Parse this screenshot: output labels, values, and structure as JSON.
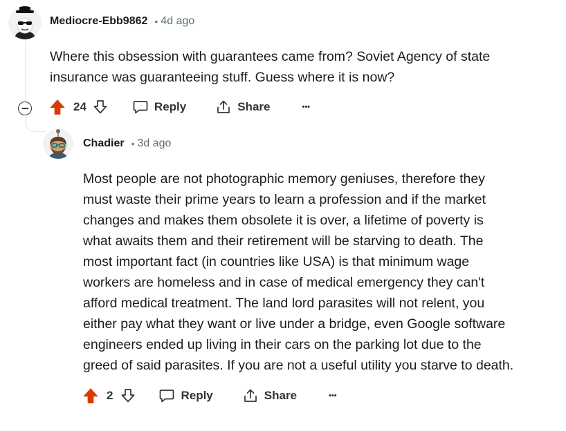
{
  "comments": [
    {
      "username": "Mediocre-Ebb9862",
      "separator": "•",
      "time": "4d ago",
      "body_lines": [
        "Where this obsession with guarantees came from? Soviet Agency of state",
        "insurance was guaranteeing stuff. Guess where it is now?"
      ],
      "votes": "24",
      "reply_label": "Reply",
      "share_label": "Share",
      "more_label": "•••"
    },
    {
      "username": "Chadier",
      "separator": "•",
      "time": "3d ago",
      "body_lines": [
        "Most people are not photographic memory geniuses, therefore they",
        "must waste their prime years to learn a profession and if the market",
        "changes and makes them obsolete it is over, a lifetime of poverty is",
        "what awaits them and their retirement will be starving to death. The",
        "most important fact (in countries like USA) is that minimum wage",
        "workers are homeless and in case of medical emergency they can't",
        "afford medical treatment. The land lord parasites will not relent, you",
        "either pay what they want or live under a bridge, even Google software",
        "engineers ended up living in their cars on the parking lot due to the",
        "greed of said parasites. If you are not a useful utility you starve to death."
      ],
      "votes": "2",
      "reply_label": "Reply",
      "share_label": "Share",
      "more_label": "•••"
    }
  ],
  "colors": {
    "upvote_active": "#d93a00",
    "thread_line": "#e5e7e8"
  },
  "icons": {
    "upvote": "arrow-up-icon",
    "downvote": "arrow-down-icon",
    "reply": "speech-bubble-icon",
    "share": "share-icon",
    "collapse": "minus-circle-icon"
  }
}
